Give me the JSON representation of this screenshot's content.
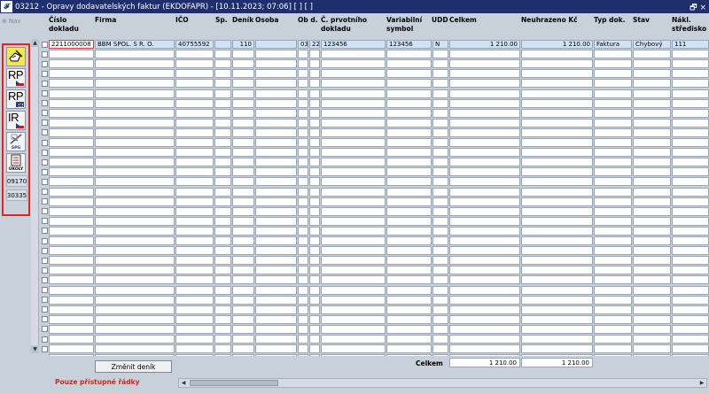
{
  "window": {
    "title": "03212 - Opravy dodavatelských faktur (EKDOFAPR) - [10.11.2023; 07:06]  [ ]  [ ]",
    "app_icon": "app-logo-icon",
    "restore_icon": "window-restore-icon",
    "restore_glyph": "🗗 ×"
  },
  "nav": {
    "label": "Nav",
    "icon": "navigate-icon"
  },
  "side_buttons": [
    {
      "name": "edit-hand-button",
      "icon": "hand-pencil-icon",
      "label": ""
    },
    {
      "name": "rp-cz-button",
      "icon": "cz-flag-icon",
      "label": "RP"
    },
    {
      "name": "rp-eu-button",
      "icon": "eu-flag-icon",
      "label": "RP"
    },
    {
      "name": "ir-cz-button",
      "icon": "cz-flag-icon",
      "label": "IR"
    },
    {
      "name": "spg-button",
      "icon": "spg-icon",
      "label": "SPG"
    },
    {
      "name": "ukoly-button",
      "icon": "tasks-icon",
      "label": "ÚKOLY"
    }
  ],
  "side_codes": [
    "09170",
    "30335"
  ],
  "columns": [
    "Číslo dokladu",
    "Firma",
    "IČO",
    "Sp.",
    "Deník",
    "Osoba",
    "Ob d.",
    "Č. prvotního dokladu",
    "Variabilní symbol",
    "UDD",
    "Celkem",
    "Neuhrazeno Kč",
    "Typ dok.",
    "Stav",
    "Nákl. středisko"
  ],
  "rows": [
    {
      "cislo_dokladu": "2211000008",
      "firma": "BBM SPOL. S R. O.",
      "ico": "40755592",
      "sp": "",
      "denik": "110",
      "osoba": "",
      "ob_a": "03",
      "ob_b": "22",
      "prvotni_doklad": "123456",
      "var_symbol": "123456",
      "udd": "N",
      "celkem": "1 210.00",
      "neuhrazeno": "1 210.00",
      "typ_dok": "Faktura",
      "stav": "Chybový",
      "nakl_stredisko": "111"
    }
  ],
  "empty_row_count": 33,
  "footer": {
    "change_journal_button": "Změnit deník",
    "total_label": "Celkem",
    "total_celkem": "1 210.00",
    "total_neuhrazeno": "1 210.00",
    "note": "Pouze přístupné řádky"
  },
  "colors": {
    "titlebar": "#1f2f6e",
    "highlight_border": "#e82222",
    "active_row": "#cfe3f7",
    "note": "#e0201e"
  }
}
